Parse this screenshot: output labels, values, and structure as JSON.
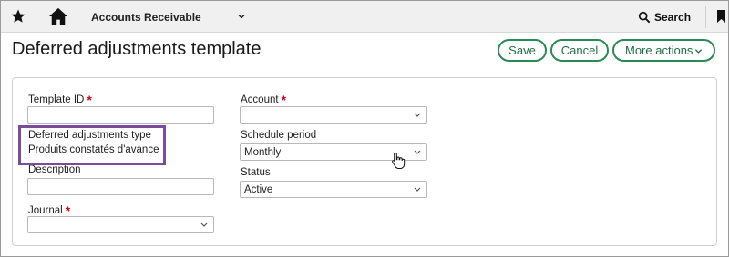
{
  "topbar": {
    "module": "Accounts Receivable",
    "search_label": "Search",
    "icons": [
      "star-icon",
      "home-icon",
      "chevron-down-icon",
      "search-icon",
      "bookmark-icon"
    ]
  },
  "header": {
    "title": "Deferred adjustments template",
    "save_label": "Save",
    "cancel_label": "Cancel",
    "more_label": "More actions"
  },
  "form": {
    "template_id": {
      "label": "Template ID",
      "value": ""
    },
    "def_type": {
      "label": "Deferred adjustments type",
      "value": "Produits constatés d'avance"
    },
    "description": {
      "label": "Description",
      "value": ""
    },
    "journal": {
      "label": "Journal",
      "value": ""
    },
    "account": {
      "label": "Account",
      "value": ""
    },
    "schedule_period": {
      "label": "Schedule period",
      "value": "Monthly"
    },
    "status": {
      "label": "Status",
      "value": "Active"
    }
  },
  "colors": {
    "accent": "#2a8a56",
    "required": "#d0021b",
    "highlight": "#7a4c9a",
    "topbar_bg": "#f0f0f0"
  }
}
